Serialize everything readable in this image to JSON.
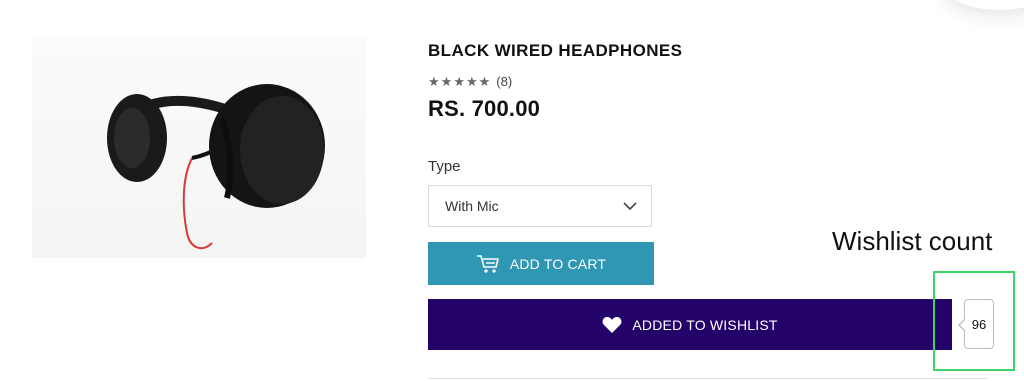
{
  "product": {
    "title": "BLACK WIRED HEADPHONES",
    "rating_stars": 5,
    "review_count": "(8)",
    "price": "RS. 700.00",
    "image_icon": "headphones-image"
  },
  "options": {
    "type_label": "Type",
    "selected_value": "With Mic"
  },
  "actions": {
    "add_to_cart_label": "ADD TO CART",
    "add_to_wishlist_label": "ADDED TO WISHLIST",
    "wishlist_count": "96"
  },
  "annotation": {
    "label": "Wishlist count"
  },
  "colors": {
    "cart_button": "#2f97b4",
    "wishlist_button": "#23026a",
    "annotation_border": "#3fd36b"
  }
}
